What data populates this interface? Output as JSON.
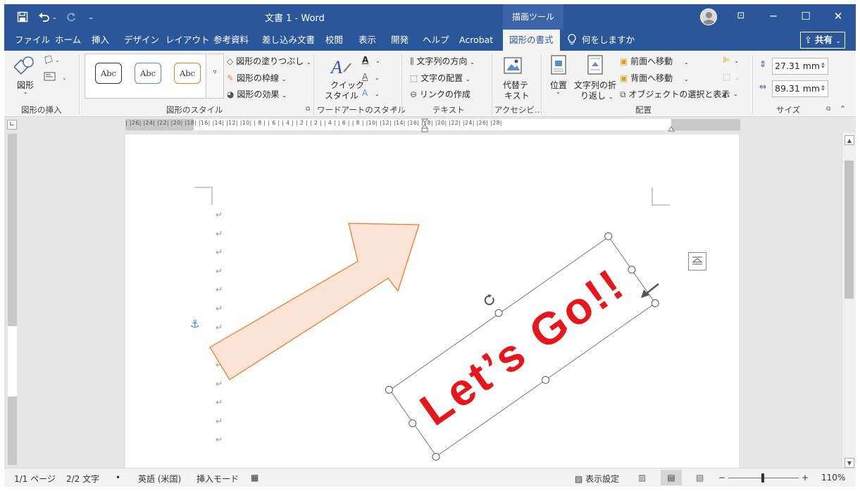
{
  "titlebar": {
    "title": "文書 1  -  Word",
    "context_tab": "描画ツール",
    "undo_icon": "undo-icon",
    "redo_icon": "redo-icon",
    "save_icon": "save-icon",
    "minimize": "─",
    "maximize": "☐",
    "close": "✕",
    "ribbon_display": "⊡"
  },
  "tabs": {
    "items": [
      "ファイル",
      "ホーム",
      "挿入",
      "デザイン",
      "レイアウト",
      "参考資料",
      "差し込み文書",
      "校閲",
      "表示",
      "開発",
      "ヘルプ",
      "Acrobat",
      "図形の書式"
    ],
    "tell_me": "何をしますか",
    "share": "共有"
  },
  "ribbon": {
    "insert_shapes": {
      "shapes_label": "図形",
      "group": "図形の挿入"
    },
    "shape_styles": {
      "abc": [
        "Abc",
        "Abc",
        "Abc"
      ],
      "fill": "図形の塗りつぶし",
      "outline": "図形の枠線",
      "effects": "図形の効果",
      "group": "図形のスタイル"
    },
    "wordart": {
      "quick_style_1": "クイック",
      "quick_style_2": "スタイル",
      "group": "ワードアートのスタイル"
    },
    "text": {
      "direction": "文字列の方向",
      "align": "文字の配置",
      "link": "リンクの作成",
      "group": "テキスト"
    },
    "accessibility": {
      "alt_text_1": "代替テ",
      "alt_text_2": "キスト",
      "group": "アクセシビ…"
    },
    "arrange": {
      "position": "位置",
      "wrap_1": "文字列の折",
      "wrap_2": "り返し",
      "forward": "前面へ移動",
      "backward": "背面へ移動",
      "selection": "オブジェクトの選択と表示",
      "group": "配置"
    },
    "size": {
      "height": "27.31 mm",
      "width": "89.31 mm",
      "group": "サイズ"
    }
  },
  "ruler": {
    "numbers": "|   |26|  |24|  |22|  |20|  |18|  |16|  |14|  |12|  |10|  | 8 |  | 6 |  | 4 |  | 2 |         | 2 |  | 4 |  | 6 |  | 8 |  |10|  |12|  |14|  |16|  |18|  |20|  |22|  |24|  |26|  |28|"
  },
  "document": {
    "wordart_text": "Let’s Go!!",
    "para_mark": "↵",
    "anchor": "⚓"
  },
  "status": {
    "page": "1/1 ページ",
    "words": "2/2 文字",
    "lang": "英語 (米国)",
    "mode": "挿入モード",
    "display_settings": "表示設定",
    "zoom": "110%"
  },
  "colors": {
    "brand": "#2b579a",
    "arrow_fill": "#fbe3d6",
    "arrow_stroke": "#ed7d31",
    "wordart": "#e8161b"
  }
}
